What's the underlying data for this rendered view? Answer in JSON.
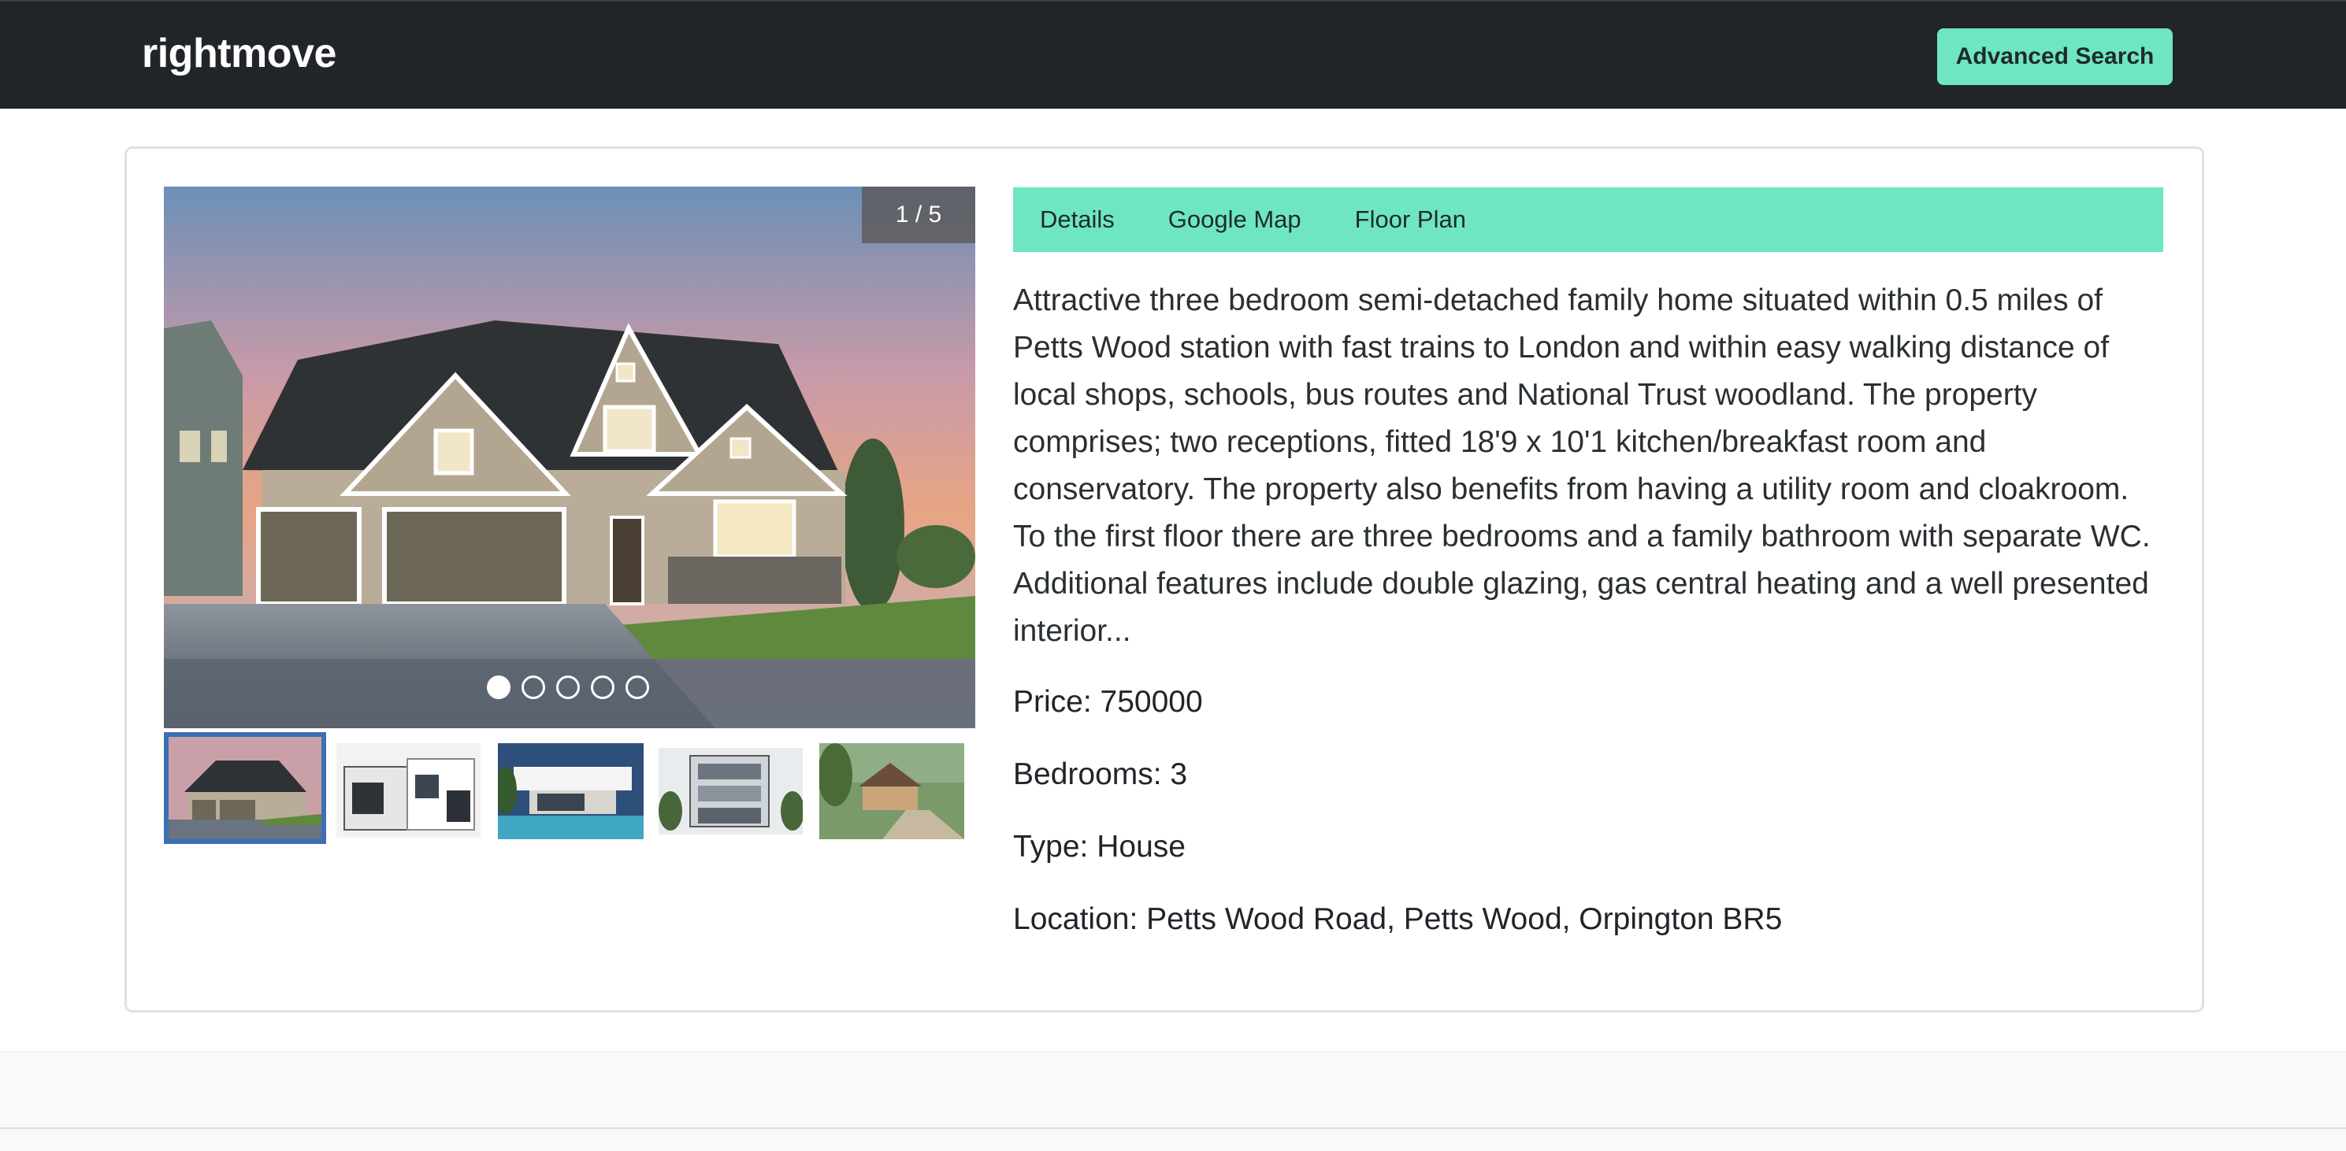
{
  "navbar": {
    "brand": "rightmove",
    "advanced_search_label": "Advanced Search"
  },
  "gallery": {
    "counter": "1 / 5",
    "current_index": 1,
    "total": 5,
    "thumbnails": [
      "house-photo-1",
      "house-photo-2",
      "house-photo-3",
      "house-photo-4",
      "house-photo-5"
    ]
  },
  "tabs": [
    {
      "label": "Details"
    },
    {
      "label": "Google Map"
    },
    {
      "label": "Floor Plan"
    }
  ],
  "property": {
    "description": "Attractive three bedroom semi-detached family home situated within 0.5 miles of Petts Wood station with fast trains to London and within easy walking distance of local shops, schools, bus routes and National Trust woodland. The property comprises; two receptions, fitted 18'9 x 10'1 kitchen/breakfast room and conservatory. The property also benefits from having a utility room and cloakroom. To the first floor there are three bedrooms and a family bathroom with separate WC. Additional features include double glazing, gas central heating and a well presented interior...",
    "price": "Price: 750000",
    "bedrooms": "Bedrooms: 3",
    "type": "Type: House",
    "location": "Location: Petts Wood Road, Petts Wood, Orpington BR5"
  },
  "colors": {
    "navbar": "#212529",
    "accent": "#6ee6c4",
    "thumb_active_border": "#3b6fb6"
  }
}
